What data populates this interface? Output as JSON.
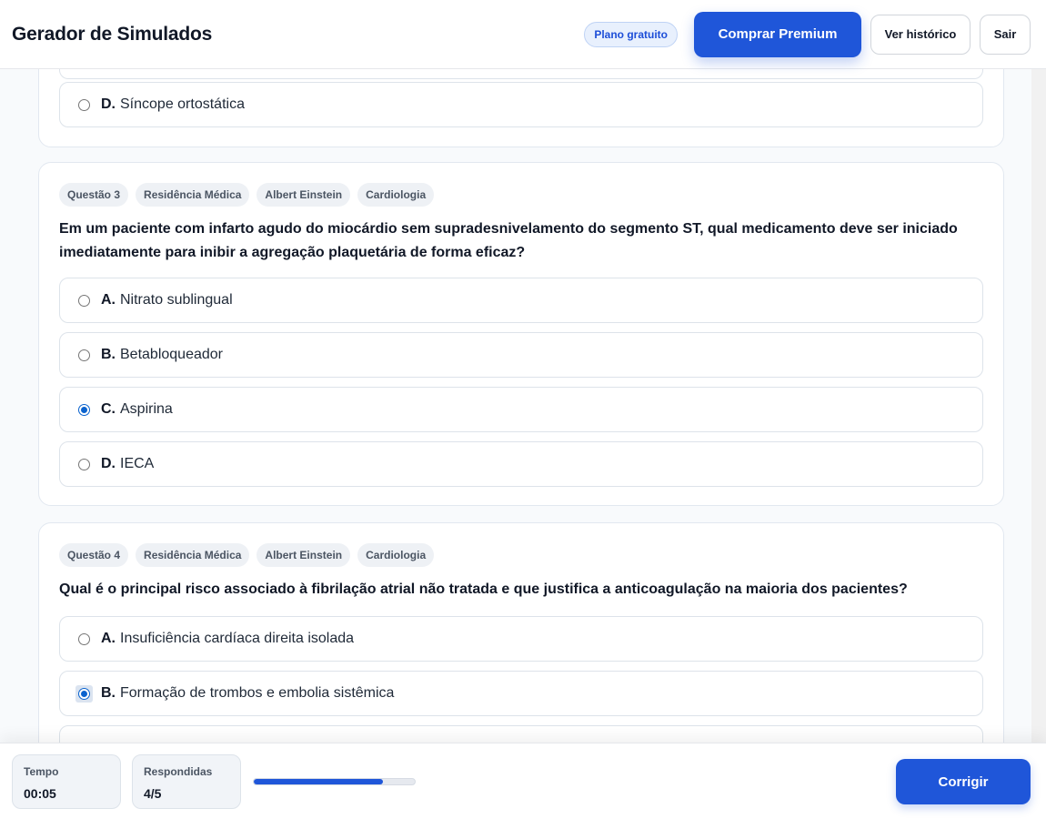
{
  "header": {
    "title": "Gerador de Simulados",
    "plan_badge": "Plano gratuito",
    "premium_button": "Comprar Premium",
    "history_button": "Ver histórico",
    "exit_button": "Sair"
  },
  "questions": [
    {
      "options": [
        {
          "letter": "D.",
          "text": "Síncope ortostática",
          "selected": false
        }
      ]
    },
    {
      "tags": [
        "Questão 3",
        "Residência Médica",
        "Albert Einstein",
        "Cardiologia"
      ],
      "text": "Em um paciente com infarto agudo do miocárdio sem supradesnivelamento do segmento ST, qual medicamento deve ser iniciado imediatamente para inibir a agregação plaquetária de forma eficaz?",
      "options": [
        {
          "letter": "A.",
          "text": "Nitrato sublingual",
          "selected": false
        },
        {
          "letter": "B.",
          "text": "Betabloqueador",
          "selected": false
        },
        {
          "letter": "C.",
          "text": "Aspirina",
          "selected": true
        },
        {
          "letter": "D.",
          "text": "IECA",
          "selected": false
        }
      ]
    },
    {
      "tags": [
        "Questão 4",
        "Residência Médica",
        "Albert Einstein",
        "Cardiologia"
      ],
      "text": "Qual é o principal risco associado à fibrilação atrial não tratada e que justifica a anticoagulação na maioria dos pacientes?",
      "options": [
        {
          "letter": "A.",
          "text": "Insuficiência cardíaca direita isolada",
          "selected": false
        },
        {
          "letter": "B.",
          "text": "Formação de trombos e embolia sistêmica",
          "selected": true
        }
      ]
    }
  ],
  "footer": {
    "time_label": "Tempo",
    "time_value": "00:05",
    "answered_label": "Respondidas",
    "answered_value": "4/5",
    "progress_fraction": 0.8,
    "correct_button": "Corrigir"
  },
  "colors": {
    "accent": "#1f56d9",
    "radio_checked": "#0b63ce"
  }
}
